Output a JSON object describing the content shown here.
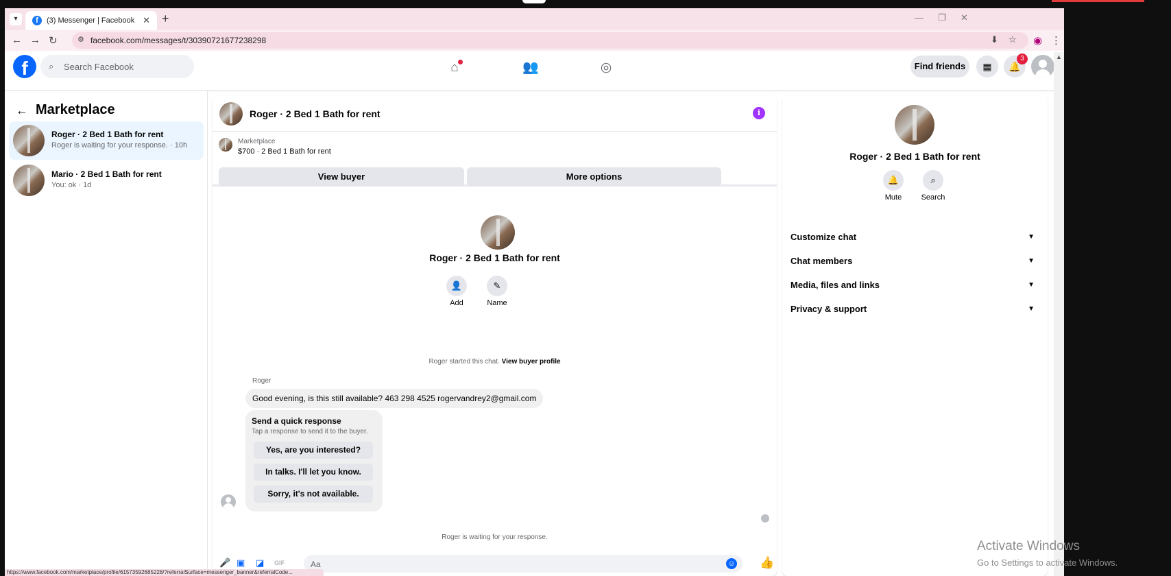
{
  "browser": {
    "tab_title": "(3) Messenger | Facebook",
    "url": "facebook.com/messages/t/30390721677238298",
    "status_url": "https://www.facebook.com/marketplace/profile/61573592685228/?referralSurface=messenger_banner&referralCode..."
  },
  "header": {
    "search_placeholder": "Search Facebook",
    "find_friends": "Find friends",
    "notification_count": "3"
  },
  "sidebar": {
    "title": "Marketplace",
    "conversations": [
      {
        "name": "Roger · 2 Bed 1 Bath for rent",
        "preview": "Roger is waiting for your response. · 10h"
      },
      {
        "name": "Mario · 2 Bed 1 Bath for rent",
        "preview": "You: ok · 1d"
      }
    ]
  },
  "chat": {
    "title": "Roger · 2 Bed 1 Bath for rent",
    "listing_source": "Marketplace",
    "listing_value": "$700 · 2 Bed 1 Bath for rent",
    "view_buyer": "View buyer",
    "more_options": "More options",
    "intro_name": "Roger · 2 Bed 1 Bath for rent",
    "add_label": "Add",
    "name_label": "Name",
    "started_text": "Roger started this chat.",
    "view_buyer_profile": "View buyer profile",
    "sender": "Roger",
    "message": "Good evening, is this still available? 463 298 4525 rogervandrey2@gmail.com",
    "quick_title": "Send a quick response",
    "quick_sub": "Tap a response to send it to the buyer.",
    "quick_responses": [
      "Yes, are you interested?",
      "In talks. I'll let you know.",
      "Sorry, it's not available."
    ],
    "waiting": "Roger is waiting for your response.",
    "composer_placeholder": "Aa"
  },
  "info": {
    "name": "Roger · 2 Bed 1 Bath for rent",
    "mute": "Mute",
    "search": "Search",
    "sections": [
      "Customize chat",
      "Chat members",
      "Media, files and links",
      "Privacy & support"
    ]
  },
  "watermark": {
    "line1": "Activate Windows",
    "line2": "Go to Settings to activate Windows."
  }
}
